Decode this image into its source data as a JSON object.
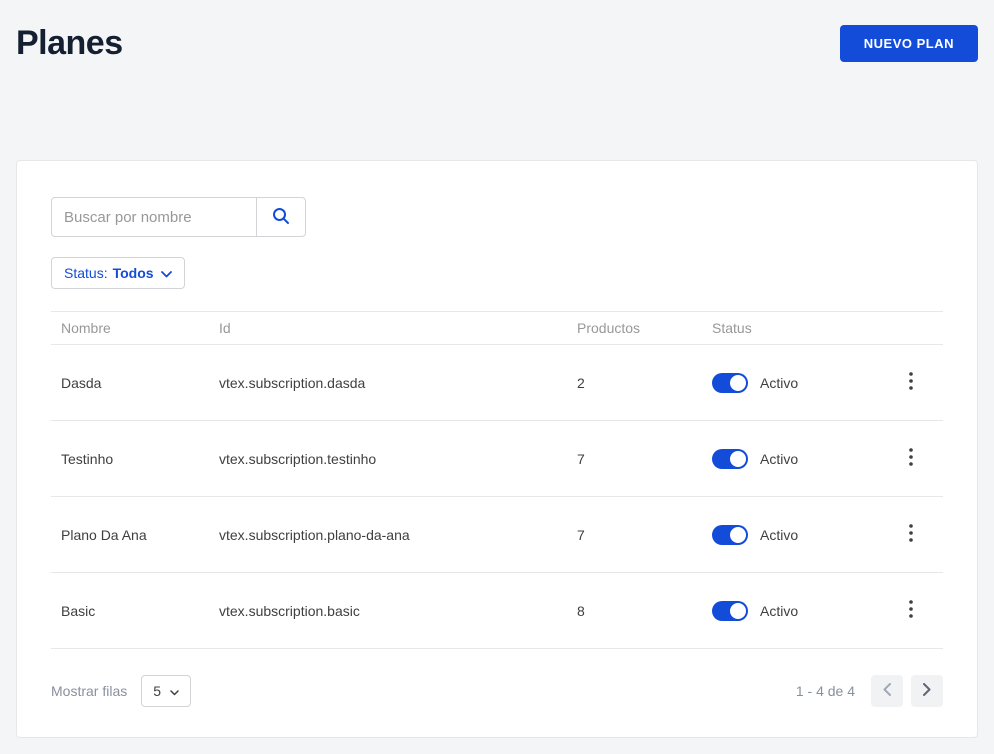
{
  "page": {
    "title": "Planes",
    "new_plan_button": "NUEVO PLAN"
  },
  "toolbar": {
    "search_placeholder": "Buscar por nombre",
    "status_filter_prefix": "Status:",
    "status_filter_value": "Todos"
  },
  "table": {
    "columns": [
      "Nombre",
      "Id",
      "Productos",
      "Status"
    ],
    "rows": [
      {
        "name": "Dasda",
        "id": "vtex.subscription.dasda",
        "products": "2",
        "status": "Activo",
        "active": true
      },
      {
        "name": "Testinho",
        "id": "vtex.subscription.testinho",
        "products": "7",
        "status": "Activo",
        "active": true
      },
      {
        "name": "Plano Da Ana",
        "id": "vtex.subscription.plano-da-ana",
        "products": "7",
        "status": "Activo",
        "active": true
      },
      {
        "name": "Basic",
        "id": "vtex.subscription.basic",
        "products": "8",
        "status": "Activo",
        "active": true
      }
    ]
  },
  "footer": {
    "rows_label": "Mostrar filas",
    "rows_value": "5",
    "range_label": "1 - 4 de 4"
  },
  "icons": {
    "search": "magnifier",
    "chevron_down": "chevron-down",
    "kebab": "vertical-dots",
    "chevron_left": "chevron-left",
    "chevron_right": "chevron-right"
  },
  "colors": {
    "accent": "#134cd8",
    "title": "#142032",
    "muted": "#979899",
    "border": "#e6e7e9",
    "background": "#f4f5f7"
  }
}
